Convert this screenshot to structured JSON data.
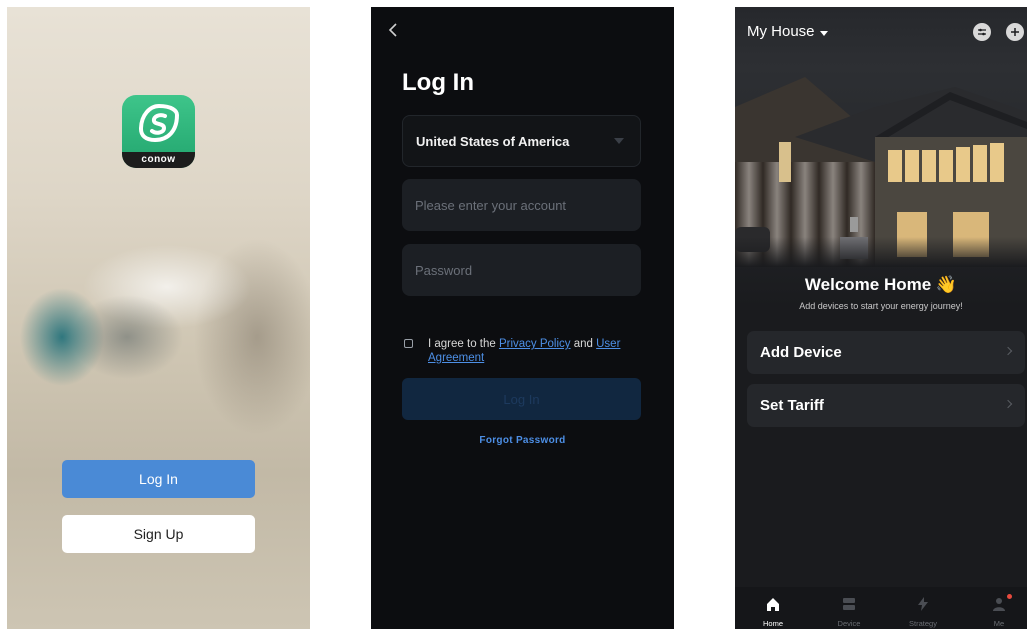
{
  "splash": {
    "logo_text": "conow",
    "login_label": "Log In",
    "signup_label": "Sign Up"
  },
  "login": {
    "title": "Log In",
    "country": "United States of America",
    "account_placeholder": "Please enter your account",
    "password_placeholder": "Password",
    "agree_prefix": "I agree to the ",
    "privacy_link": "Privacy Policy",
    "agree_and": " and ",
    "agreement_link": "User Agreement",
    "login_button": "Log In",
    "forgot_password": "Forgot Password"
  },
  "home": {
    "house_name": "My House",
    "welcome_title": "Welcome Home",
    "welcome_emoji": "👋",
    "welcome_subtitle": "Add devices to start your energy journey!",
    "cards": [
      {
        "label": "Add Device"
      },
      {
        "label": "Set Tariff"
      }
    ],
    "tabs": [
      {
        "label": "Home",
        "icon": "home-icon",
        "active": true
      },
      {
        "label": "Device",
        "icon": "device-icon",
        "active": false
      },
      {
        "label": "Strategy",
        "icon": "bolt-icon",
        "active": false
      },
      {
        "label": "Me",
        "icon": "person-icon",
        "active": false
      }
    ]
  },
  "colors": {
    "brand_green": "#2bb57a",
    "primary_blue": "#4a8ad6",
    "link_blue": "#4d8fe6",
    "dark_bg": "#0c0d10",
    "badge_red": "#e84a3e"
  }
}
